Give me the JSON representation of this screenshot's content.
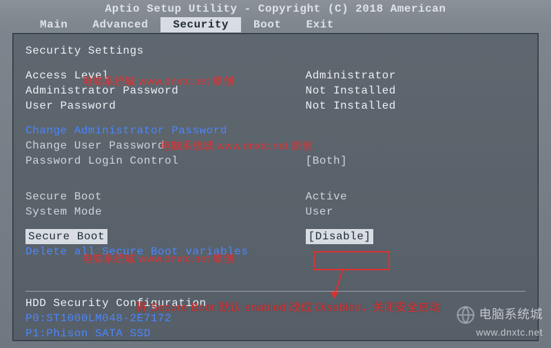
{
  "titlebar": "Aptio Setup Utility - Copyright (C) 2018 American",
  "menu": {
    "items": [
      "Main",
      "Advanced",
      "Security",
      "Boot",
      "Exit"
    ],
    "active_index": 2
  },
  "section_title": "Security Settings",
  "access": {
    "label": "Access Level",
    "value": "Administrator"
  },
  "admin_pw": {
    "label": "Administrator Password",
    "value": "Not Installed"
  },
  "user_pw": {
    "label": "User Password",
    "value": "Not Installed"
  },
  "change_admin_pw": "Change Administrator Password",
  "change_user_pw": "Change User Password",
  "pw_login_ctrl": {
    "label": "Password Login Control",
    "value": "[Both]"
  },
  "secure_boot_status": {
    "label": "Secure Boot",
    "value": "Active"
  },
  "system_mode": {
    "label": "System Mode",
    "value": "User"
  },
  "secure_boot_setting": {
    "label": "Secure Boot",
    "value": "[Disable]"
  },
  "delete_sb_vars": "Delete all Secure Boot variables",
  "hdd_section": "HDD Security Configuration",
  "hdd_items": [
    "P0:ST1000LM048-2E7172",
    "P1:Phison SATA SSD"
  ],
  "annotation_note": "将 Secure Boot 默认 enabled 改成 Disabled，关闭安全启动",
  "watermark_text": "电脑系统城 www.dnxtc.net 原创",
  "site_logo_text": "电脑系统城",
  "site_logo_url": "www.dnxtc.net"
}
